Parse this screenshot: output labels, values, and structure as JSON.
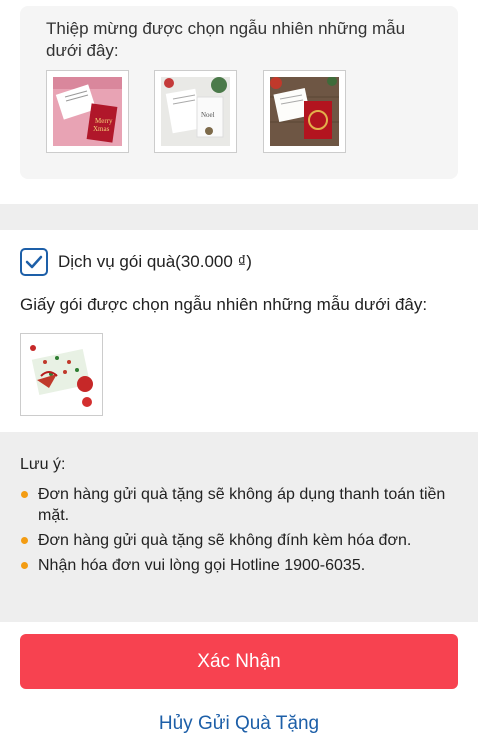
{
  "card_section": {
    "description": "Thiệp mừng được chọn ngẫu nhiên những mẫu dưới đây:",
    "thumbnails": [
      {
        "icon": "greeting-card-red-image"
      },
      {
        "icon": "greeting-card-white-image"
      },
      {
        "icon": "greeting-card-wood-image"
      }
    ]
  },
  "gift_service": {
    "checked": true,
    "label": "Dịch vụ gói quà(30.000 ₫)"
  },
  "wrapping_section": {
    "description": "Giấy gói được chọn ngẫu nhiên những mẫu dưới đây:",
    "thumbnail_icon": "gift-wrap-image"
  },
  "notes": {
    "title": "Lưu ý:",
    "items": [
      "Đơn hàng gửi quà tặng sẽ không áp dụng thanh toán tiền mặt.",
      "Đơn hàng gửi quà tặng sẽ không đính kèm hóa đơn.",
      "Nhận hóa đơn vui lòng gọi Hotline 1900-6035."
    ],
    "bullet_color": "#f39c12"
  },
  "actions": {
    "confirm_label": "Xác Nhận",
    "cancel_label": "Hủy Gửi Quà Tặng",
    "confirm_color": "#f74250",
    "cancel_color": "#1d5fa8"
  }
}
